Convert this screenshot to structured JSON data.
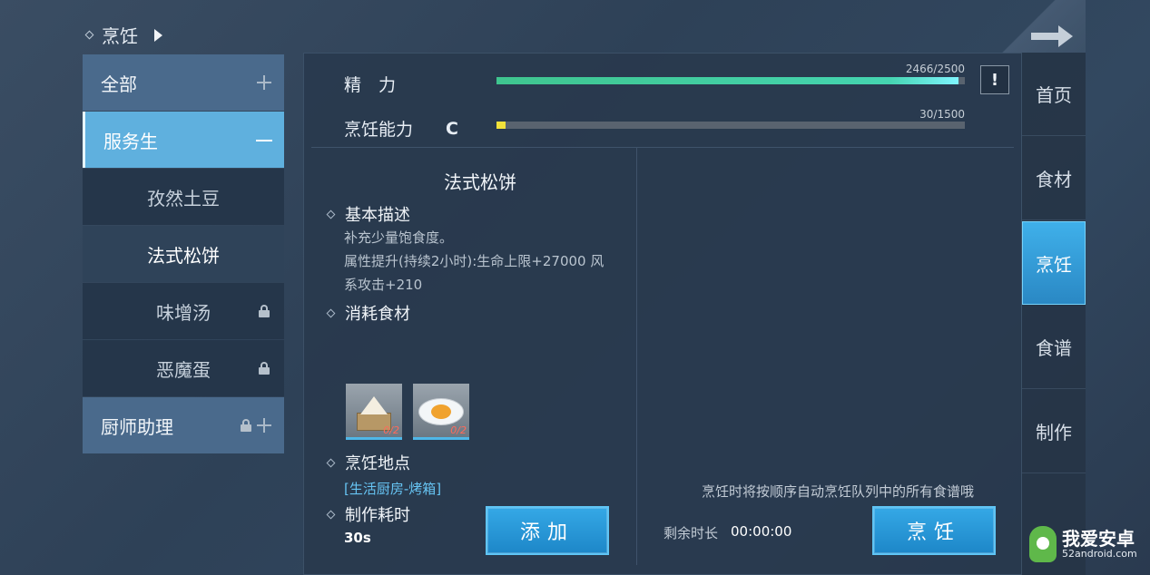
{
  "breadcrumb": {
    "label": "烹饪"
  },
  "categories": [
    {
      "label": "全部",
      "type": "main",
      "state": "collapsed"
    },
    {
      "label": "服务生",
      "type": "main",
      "state": "expanded"
    },
    {
      "label": "孜然土豆",
      "type": "sub",
      "locked": false
    },
    {
      "label": "法式松饼",
      "type": "sub",
      "locked": false,
      "selected": true
    },
    {
      "label": "味增汤",
      "type": "sub",
      "locked": true
    },
    {
      "label": "恶魔蛋",
      "type": "sub",
      "locked": true
    },
    {
      "label": "厨师助理",
      "type": "main",
      "state": "collapsed",
      "locked": true
    }
  ],
  "stats": {
    "energy": {
      "label": "精　力",
      "current": 2466,
      "max": 2500,
      "text": "2466/2500",
      "color": "#3fc58f"
    },
    "cooking": {
      "label": "烹饪能力",
      "grade": "C",
      "current": 30,
      "max": 1500,
      "text": "30/1500",
      "color": "#f2e13a"
    }
  },
  "alert": {
    "symbol": "!"
  },
  "dish": {
    "title": "法式松饼",
    "basic_heading": "基本描述",
    "desc_line1": "补充少量饱食度。",
    "desc_line2": "属性提升(持续2小时):生命上限+27000 风系攻击+210",
    "ingredients_heading": "消耗食材",
    "ingredients": [
      {
        "name": "flour",
        "count": "0/2"
      },
      {
        "name": "egg",
        "count": "0/2"
      }
    ],
    "location_heading": "烹饪地点",
    "location": "[生活厨房-烤箱]",
    "time_heading": "制作耗时",
    "time": "30s"
  },
  "buttons": {
    "add": "添加",
    "cook": "烹饪"
  },
  "queue": {
    "notice": "烹饪时将按顺序自动烹饪队列中的所有食谱哦",
    "remain_label": "剩余时长",
    "remain_value": "00:00:00"
  },
  "nav": [
    {
      "label": "首页",
      "active": false
    },
    {
      "label": "食材",
      "active": false
    },
    {
      "label": "烹饪",
      "active": true
    },
    {
      "label": "食谱",
      "active": false
    },
    {
      "label": "制作",
      "active": false
    }
  ],
  "watermark": {
    "title": "我爱安卓",
    "sub": "52android.com"
  }
}
